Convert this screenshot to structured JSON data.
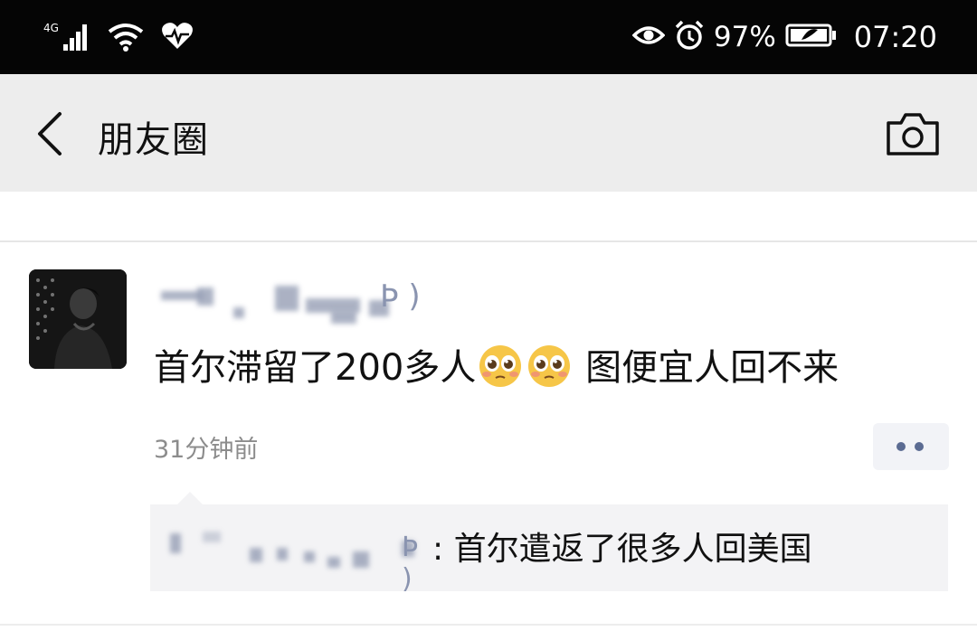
{
  "status_bar": {
    "network": "4G",
    "battery_percent": "97%",
    "time": "07:20",
    "icons": [
      "signal-icon",
      "wifi-icon",
      "health-icon",
      "eye-icon",
      "alarm-icon",
      "battery-icon"
    ]
  },
  "header": {
    "title": "朋友圈",
    "back_icon": "chevron-left-icon",
    "camera_icon": "camera-icon",
    "background": "#ededed"
  },
  "post": {
    "username_visible_fragment": "Þ )",
    "text_before_emoji": "首尔滞留了200多人",
    "emojis": [
      "pleading-face-emoji",
      "pleading-face-emoji"
    ],
    "text_after_emoji": " 图便宜人回不来",
    "time": "31分钟前",
    "comment": {
      "author_visible_fragment": "Þ )",
      "separator": ":",
      "text": "首尔遣返了很多人回美国"
    }
  },
  "colors": {
    "status_bar_bg": "#050505",
    "link_blue": "#5b6b92",
    "comment_bg": "#f3f3f5"
  }
}
